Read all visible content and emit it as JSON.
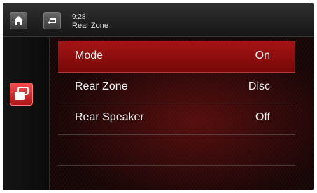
{
  "header": {
    "time": "9:28",
    "title": "Rear Zone"
  },
  "icons": {
    "home": "home-icon",
    "back": "back-icon",
    "side": "rear-zone-icon"
  },
  "menu": {
    "items": [
      {
        "label": "Mode",
        "value": "On"
      },
      {
        "label": "Rear Zone",
        "value": "Disc"
      },
      {
        "label": "Rear Speaker",
        "value": "Off"
      }
    ]
  },
  "colors": {
    "accent": "#b51515"
  }
}
